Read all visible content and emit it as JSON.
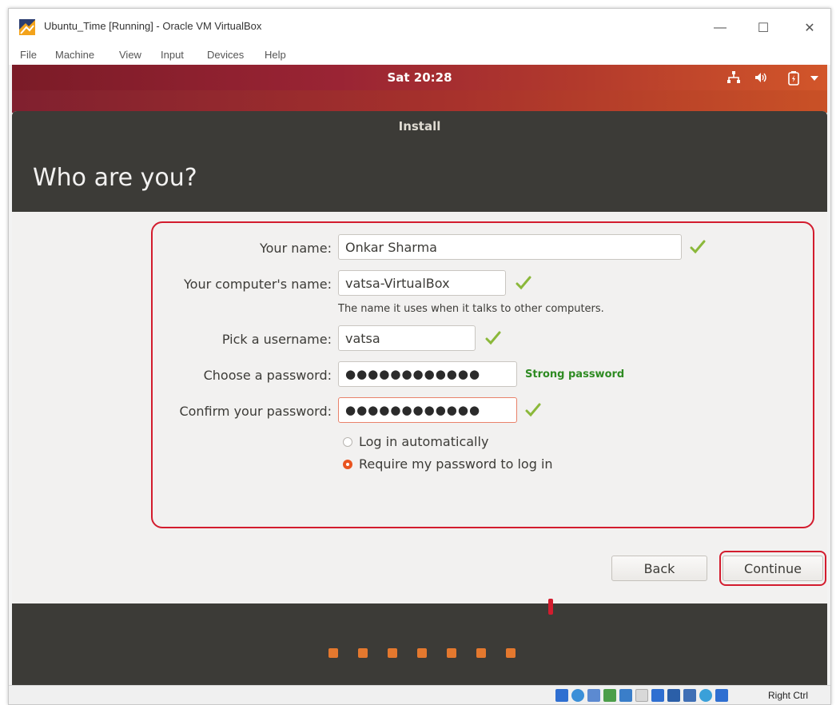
{
  "window": {
    "title": "Ubuntu_Time [Running] - Oracle VM VirtualBox",
    "menu": [
      "File",
      "Machine",
      "View",
      "Input",
      "Devices",
      "Help"
    ],
    "controls": {
      "minimize": "—",
      "maximize": "☐",
      "close": "✕"
    }
  },
  "topbar": {
    "clock": "Sat 20:28",
    "tray_icons": [
      "network-icon",
      "volume-icon",
      "battery-icon",
      "menu-arrow-icon"
    ]
  },
  "installer": {
    "title": "Install",
    "heading": "Who are you?",
    "form": {
      "name_label": "Your name:",
      "name_value": "Onkar Sharma",
      "computer_label": "Your computer's name:",
      "computer_value": "vatsa-VirtualBox",
      "computer_hint": "The name it uses when it talks to other computers.",
      "username_label": "Pick a username:",
      "username_value": "vatsa",
      "password_label": "Choose a password:",
      "password_value": "●●●●●●●●●●●●",
      "password_strength": "Strong password",
      "confirm_label": "Confirm your password:",
      "confirm_value": "●●●●●●●●●●●●",
      "login_auto": "Log in automatically",
      "login_require": "Require my password to log in",
      "selected_login": "Require my password to log in"
    },
    "buttons": {
      "back": "Back",
      "continue": "Continue"
    },
    "slideshow_dots": 7
  },
  "statusbar": {
    "host_key": "Right Ctrl"
  },
  "colors": {
    "ubuntu_orange": "#e95420",
    "annotation_red": "#d31c2e",
    "installer_header": "#3c3b37",
    "strength_green": "#2e8b22",
    "check_green": "#8bb83a"
  }
}
